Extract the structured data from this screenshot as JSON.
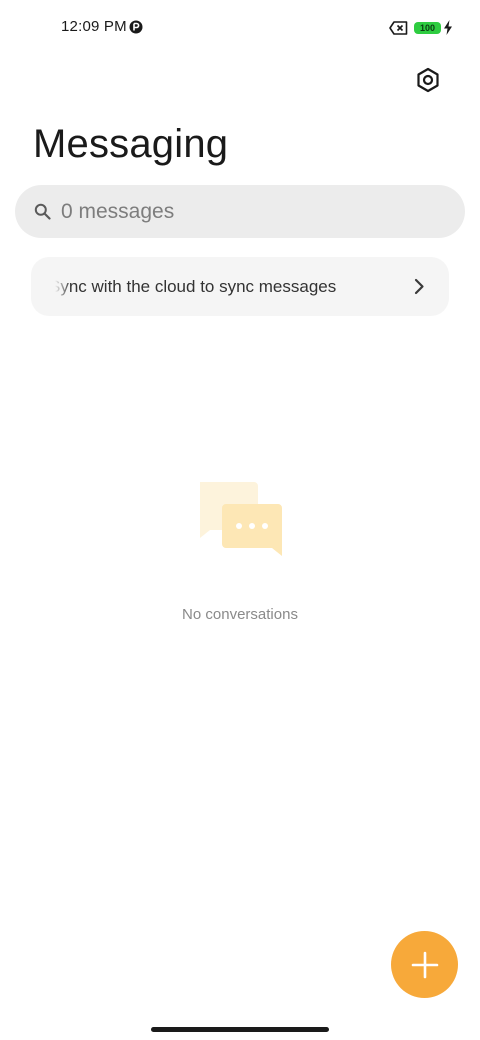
{
  "status_bar": {
    "time": "12:09 PM",
    "battery_level": "100",
    "icons": [
      "p-icon",
      "sim-x-icon",
      "battery-icon",
      "charging-bolt-icon"
    ]
  },
  "header": {
    "title": "Messaging",
    "settings_icon": "settings-icon"
  },
  "search": {
    "placeholder": "0 messages",
    "value": ""
  },
  "sync_banner": {
    "text": "Sync with the cloud to sync messages",
    "icon": "chevron-right-icon"
  },
  "empty_state": {
    "text": "No conversations",
    "icon": "chat-bubbles-illustration"
  },
  "fab": {
    "icon": "plus-icon"
  },
  "colors": {
    "accent": "#f7a93a",
    "battery": "#2ecc40",
    "search_bg": "#ececec",
    "banner_bg": "#f5f5f5",
    "illustration_back": "#fdf3dc",
    "illustration_front": "#fde7b5"
  }
}
